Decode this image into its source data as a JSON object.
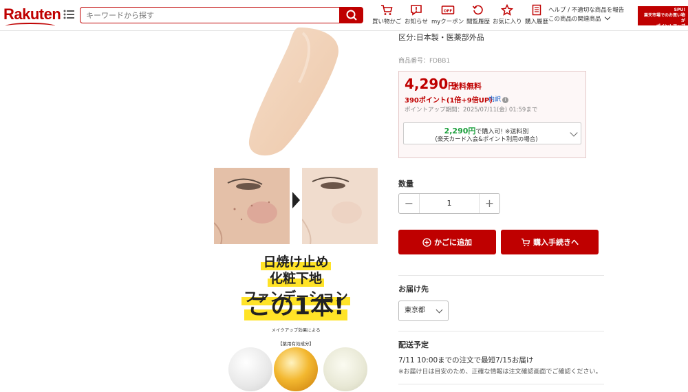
{
  "header": {
    "logo": "Rakuten",
    "search_placeholder": "キーワードから探す",
    "nav": [
      {
        "label": "買い物かご",
        "icon": "cart-icon"
      },
      {
        "label": "お知らせ",
        "icon": "notification-icon"
      },
      {
        "label": "myクーポン",
        "icon": "coupon-icon"
      },
      {
        "label": "閲覧履歴",
        "icon": "history-icon"
      },
      {
        "label": "お気に入り",
        "icon": "star-icon"
      },
      {
        "label": "購入履歴",
        "icon": "receipt-icon"
      }
    ],
    "help_line1": "ヘルプ / 不適切な商品を報告",
    "help_line2": "この商品の関連商品",
    "banner_line1": "SPU!",
    "banner_line2": "楽天市場でのお買い物が",
    "banner_line3": "ポイントアップ"
  },
  "product_images": {
    "promo_line1": "日焼け止め",
    "promo_line2a": "化粧下地",
    "promo_line2b": "ファンデーション",
    "promo_big": "この1本!",
    "promo_small": "メイクアップ効果による",
    "promo_small2": "【薬用有効成分】"
  },
  "product_info": {
    "category": "区分:日本製・医薬部外品",
    "item_number": "商品番号：FDBB1",
    "price": "4,290",
    "price_unit": "円",
    "shipping": "送料無料",
    "points": "390ポイント(1倍+9倍UP)",
    "points_detail": "内訳",
    "point_period": "ポイントアップ期間：2025/07/11(金) 01:59まで",
    "card_price": "2,290円",
    "card_suffix": "で購入可! ※送料別",
    "card_note": "(楽天カード入会&ポイント利用の場合)"
  },
  "purchase": {
    "qty_label": "数量",
    "qty_value": "1",
    "add_to_cart": "かごに追加",
    "buy_now": "購入手続きへ"
  },
  "delivery": {
    "dest_label": "お届け先",
    "dest_value": "東京都",
    "schedule_label": "配送予定",
    "schedule_text": "7/11 10:00までの注文で最短7/15お届け",
    "schedule_note": "※お届け日は目安のため、正確な情報は注文確認画面でご確認ください。"
  },
  "colors": {
    "brand": "#bf0000",
    "highlight": "#ffe327",
    "card_green": "#1a9e3a"
  }
}
